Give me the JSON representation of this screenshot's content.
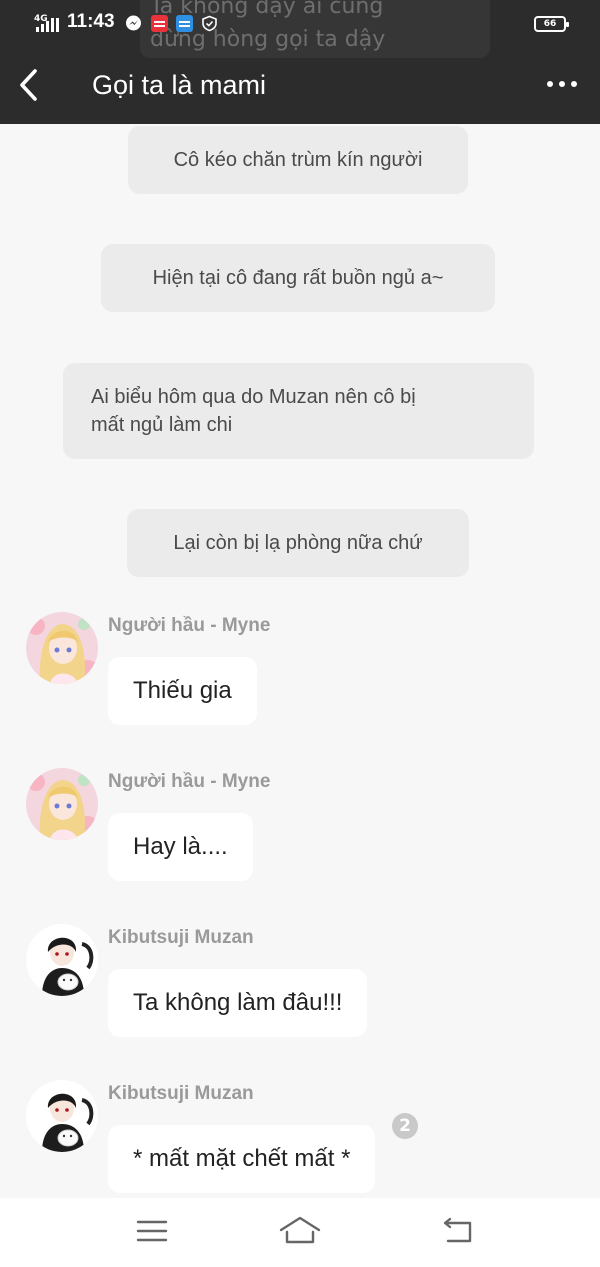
{
  "status_bar": {
    "network": "4G",
    "time": "11:43",
    "battery": "66",
    "app_icons": [
      "messenger-icon",
      "manga-toon-icon",
      "novel-toon-icon",
      "shield-icon"
    ]
  },
  "background_notification": {
    "line1": "Ta không dạy ai cũng",
    "line2": "đừng hòng gọi ta dậy"
  },
  "header": {
    "title": "Gọi ta là mami",
    "back_icon": "chevron-left-icon",
    "more_icon": "more-dots-icon"
  },
  "messages": [
    {
      "type": "narration",
      "text": "Cô kéo chăn trùm kín người"
    },
    {
      "type": "narration",
      "text": "Hiện tại cô đang rất buồn ngủ a~"
    },
    {
      "type": "narration",
      "line1": "Ai biểu hôm qua do Muzan nên cô bị",
      "line2": "mất ngủ làm chi"
    },
    {
      "type": "narration",
      "text": "Lại còn bị lạ phòng nữa chứ"
    },
    {
      "type": "chat",
      "sender": "Người hầu - Myne",
      "text": "Thiếu gia"
    },
    {
      "type": "chat",
      "sender": "Người hầu - Myne",
      "text": "Hay là...."
    },
    {
      "type": "chat",
      "sender": "Kibutsuji Muzan",
      "text": "Ta không làm đâu!!!"
    },
    {
      "type": "chat",
      "sender": "Kibutsuji Muzan",
      "text": "* mất mặt chết mất *",
      "badge": "2"
    }
  ],
  "nav_bar": {
    "menu_icon": "menu-icon",
    "home_icon": "home-icon",
    "back_icon": "return-icon"
  },
  "colors": {
    "header_bg": "#2c2c2c",
    "chat_bg": "#f7f7f7",
    "narration_bg": "#ebebeb",
    "bubble_bg": "#ffffff",
    "sender_text": "#9a9a9a"
  }
}
